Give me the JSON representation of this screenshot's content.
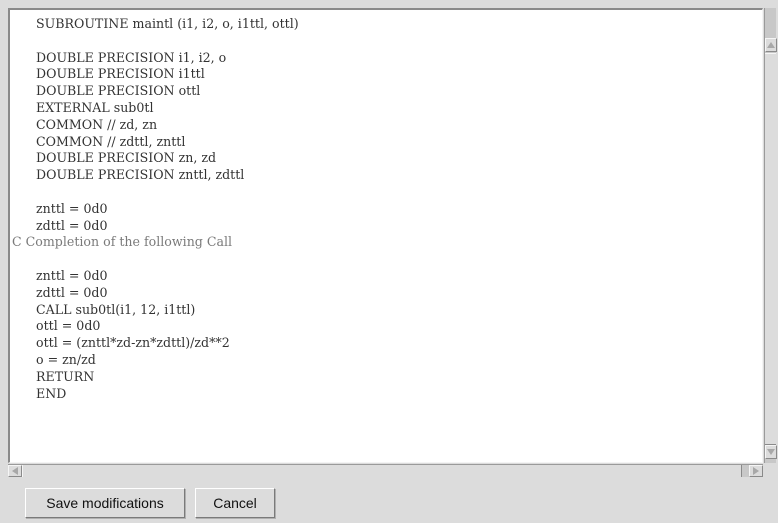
{
  "editor": {
    "lines": [
      {
        "text": "      SUBROUTINE maintl (i1, i2, o, i1ttl, ottl)",
        "comment": false
      },
      {
        "text": "",
        "comment": false
      },
      {
        "text": "      DOUBLE PRECISION i1, i2, o",
        "comment": false
      },
      {
        "text": "      DOUBLE PRECISION i1ttl",
        "comment": false
      },
      {
        "text": "      DOUBLE PRECISION ottl",
        "comment": false
      },
      {
        "text": "      EXTERNAL sub0tl",
        "comment": false
      },
      {
        "text": "      COMMON // zd, zn",
        "comment": false
      },
      {
        "text": "      COMMON // zdttl, znttl",
        "comment": false
      },
      {
        "text": "      DOUBLE PRECISION zn, zd",
        "comment": false
      },
      {
        "text": "      DOUBLE PRECISION znttl, zdttl",
        "comment": false
      },
      {
        "text": "",
        "comment": false
      },
      {
        "text": "      znttl = 0d0",
        "comment": false
      },
      {
        "text": "      zdttl = 0d0",
        "comment": false
      },
      {
        "text": "C Completion of the following Call",
        "comment": true
      },
      {
        "text": "",
        "comment": false
      },
      {
        "text": "      znttl = 0d0",
        "comment": false
      },
      {
        "text": "      zdttl = 0d0",
        "comment": false
      },
      {
        "text": "      CALL sub0tl(i1, 12, i1ttl)",
        "comment": false
      },
      {
        "text": "      ottl = 0d0",
        "comment": false
      },
      {
        "text": "      ottl = (znttl*zd-zn*zdttl)/zd**2",
        "comment": false
      },
      {
        "text": "      o = zn/zd",
        "comment": false
      },
      {
        "text": "      RETURN",
        "comment": false
      },
      {
        "text": "      END",
        "comment": false
      }
    ]
  },
  "scrollbars": {
    "vertical": {
      "up_icon": "arrow-up-icon",
      "down_icon": "arrow-down-icon"
    },
    "horizontal": {
      "left_icon": "arrow-left-icon",
      "right_icon": "arrow-right-icon"
    }
  },
  "buttons": {
    "save_label": "Save modifications",
    "cancel_label": "Cancel"
  }
}
